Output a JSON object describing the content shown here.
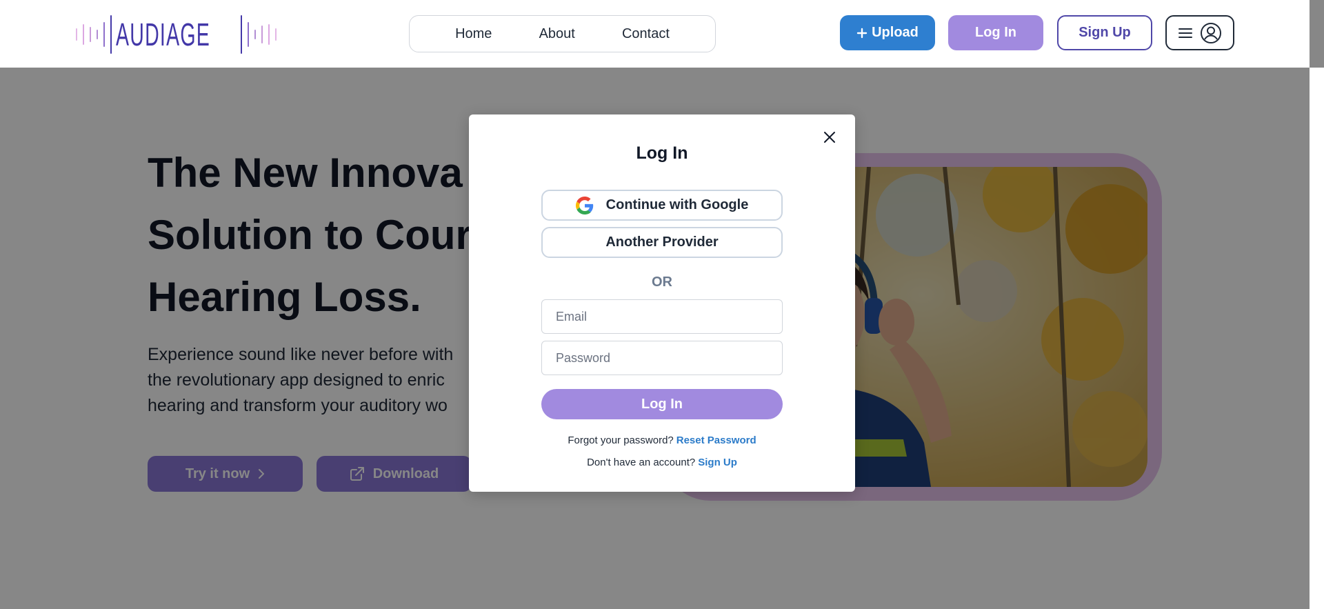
{
  "header": {
    "logo_text": "AUDIAGE",
    "nav": [
      {
        "label": "Home"
      },
      {
        "label": "About"
      },
      {
        "label": "Contact"
      }
    ],
    "upload_label": "Upload",
    "login_label": "Log In",
    "signup_label": "Sign Up"
  },
  "hero": {
    "title_lines": [
      "The New Innova",
      "Solution to Cour",
      "Hearing Loss."
    ],
    "desc_lines": [
      "Experience sound like never before with",
      "the revolutionary app designed to enric",
      "hearing and transform your auditory wo"
    ],
    "try_label": "Try it now",
    "download_label": "Download"
  },
  "modal": {
    "title": "Log In",
    "google_label": "Continue with Google",
    "provider_label": "Another Provider",
    "or_label": "OR",
    "email_placeholder": "Email",
    "password_placeholder": "Password",
    "login_label": "Log In",
    "forgot_text": "Forgot your password?",
    "reset_link": "Reset Password",
    "no_account_text": "Don't have an account?",
    "signup_link": "Sign Up"
  },
  "colors": {
    "brand": "#4338a8",
    "upload": "#2e7fd0",
    "login": "#a18adf",
    "link": "#2b7bc9"
  },
  "icons": {
    "logo": "audio-wave-icon",
    "upload": "plus-icon",
    "menu": "hamburger-icon",
    "account": "user-circle-icon",
    "try": "chevron-right-icon",
    "download": "external-link-icon",
    "close": "close-icon",
    "google": "google-icon"
  }
}
